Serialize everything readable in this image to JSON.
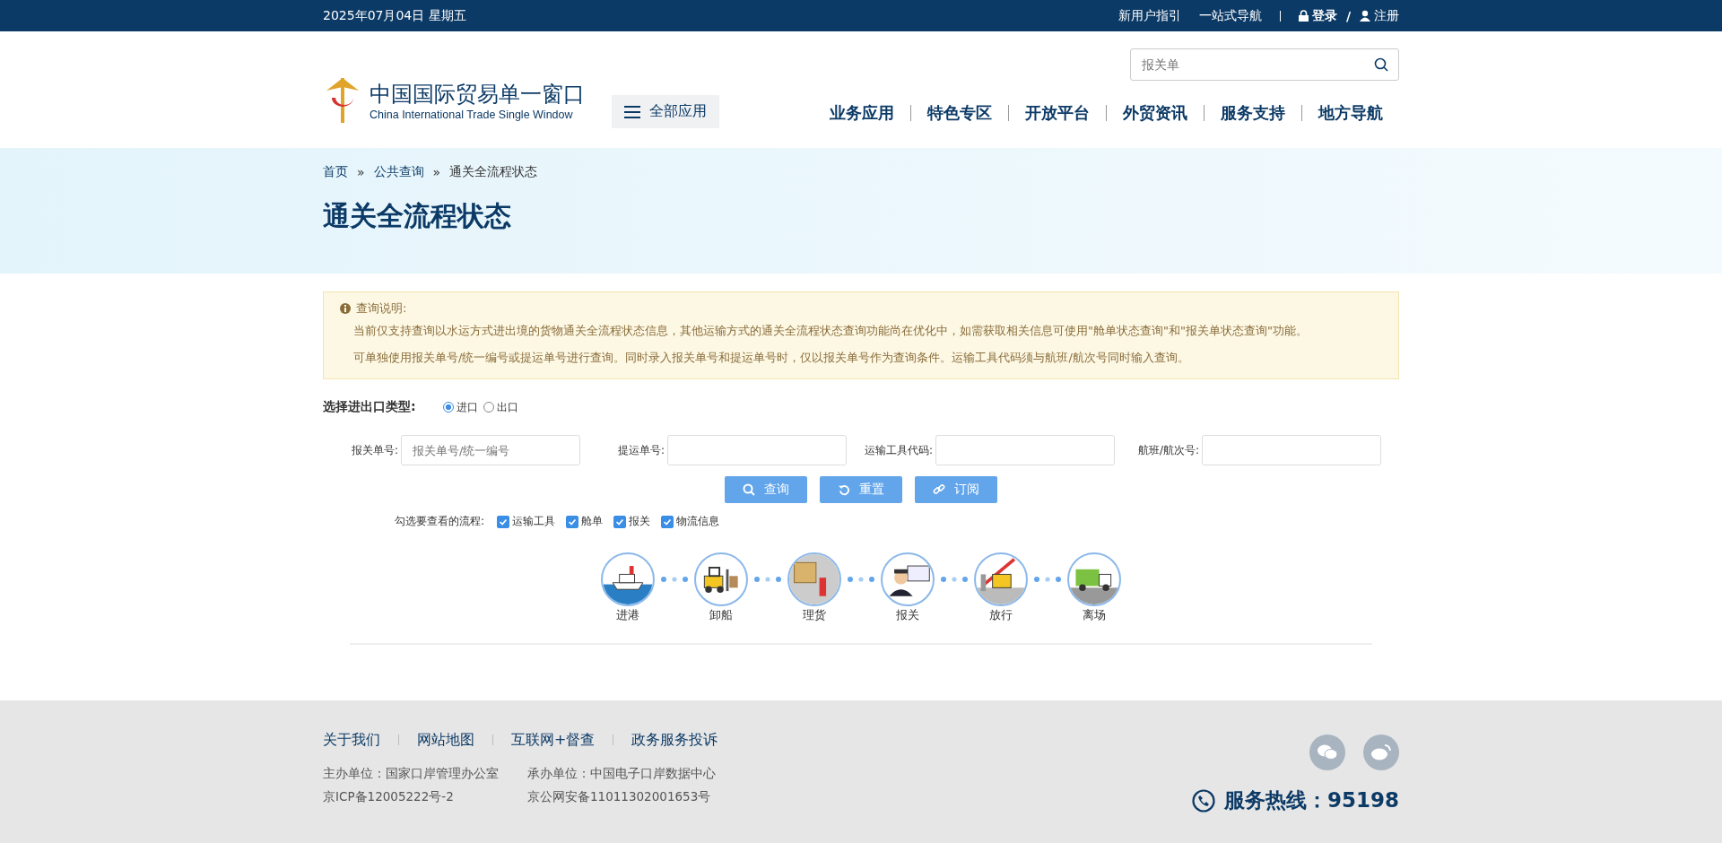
{
  "top_bar": {
    "date": "2025年07月04日 星期五",
    "links": [
      "新用户指引",
      "一站式导航"
    ],
    "login": "登录",
    "separator": "/",
    "register": "注册"
  },
  "header": {
    "logo_title": "中国国际贸易单一窗口",
    "logo_subtitle": "China International Trade Single Window",
    "all_apps": "全部应用",
    "search": {
      "placeholder": "报关单"
    },
    "nav": [
      "业务应用",
      "特色专区",
      "开放平台",
      "外贸资讯",
      "服务支持",
      "地方导航"
    ]
  },
  "banner": {
    "breadcrumb": [
      "首页",
      "公共查询",
      "通关全流程状态"
    ],
    "separator": "»",
    "title": "通关全流程状态"
  },
  "notice": {
    "heading": "查询说明:",
    "lines": [
      "当前仅支持查询以水运方式进出境的货物通关全流程状态信息，其他运输方式的通关全流程状态查询功能尚在优化中，如需获取相关信息可使用\"舱单状态查询\"和\"报关单状态查询\"功能。",
      "可单独使用报关单号/统一编号或提运单号进行查询。同时录入报关单号和提运单号时，仅以报关单号作为查询条件。运输工具代码须与航班/航次号同时输入查询。"
    ]
  },
  "type_select": {
    "label": "选择进出口类型:",
    "options": [
      {
        "label": "进口",
        "selected": true
      },
      {
        "label": "出口",
        "selected": false
      }
    ]
  },
  "fields": [
    {
      "label": "报关单号:",
      "placeholder": "报关单号/统一编号"
    },
    {
      "label": "提运单号:"
    },
    {
      "label": "运输工具代码:"
    },
    {
      "label": "航班/航次号:"
    }
  ],
  "buttons": [
    {
      "kind": "search",
      "label": "查询"
    },
    {
      "kind": "reset",
      "label": "重置"
    },
    {
      "kind": "subscribe",
      "label": "订阅"
    }
  ],
  "flow_select": {
    "label": "勾选要查看的流程:",
    "options": [
      {
        "label": "运输工具",
        "checked": true
      },
      {
        "label": "舱单",
        "checked": true
      },
      {
        "label": "报关",
        "checked": true
      },
      {
        "label": "物流信息",
        "checked": true
      }
    ]
  },
  "steps": [
    {
      "kind": "ship",
      "label": "进港"
    },
    {
      "kind": "forklift",
      "label": "卸船"
    },
    {
      "kind": "boxes",
      "label": "理货"
    },
    {
      "kind": "officer",
      "label": "报关"
    },
    {
      "kind": "gate",
      "label": "放行"
    },
    {
      "kind": "truck",
      "label": "离场"
    }
  ],
  "footer": {
    "links": [
      "关于我们",
      "网站地图",
      "互联网+督查",
      "政务服务投诉"
    ],
    "info": [
      [
        "主办单位：国家口岸管理办公室",
        "京ICP备12005222号-2"
      ],
      [
        "承办单位：中国电子口岸数据中心",
        "京公网安备11011302001653号"
      ]
    ],
    "hotline": "服务热线：95198"
  }
}
